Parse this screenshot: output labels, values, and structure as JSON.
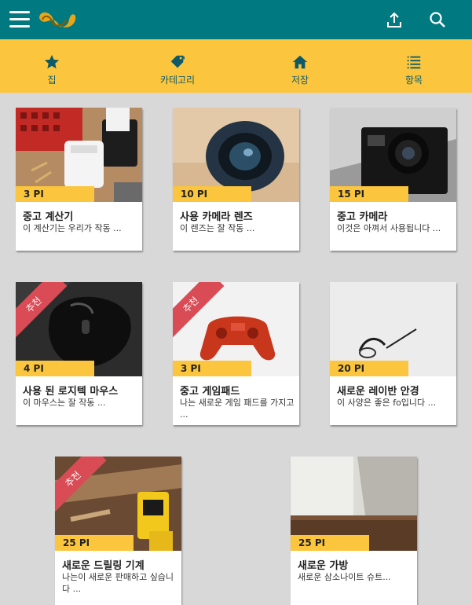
{
  "header": {
    "menu_icon": "hamburger-icon",
    "logo": "brand-logo",
    "share_icon": "upload-share-icon",
    "search_icon": "search-icon"
  },
  "tabs": [
    {
      "label": "집",
      "icon": "star-icon"
    },
    {
      "label": "카테고리",
      "icon": "tag-icon"
    },
    {
      "label": "저장",
      "icon": "home-icon"
    },
    {
      "label": "항목",
      "icon": "list-icon"
    }
  ],
  "products": [
    {
      "price": "3 PI",
      "title": "중고 계산기",
      "desc": "이 계산기는 우리가 작동 ...",
      "badge": ""
    },
    {
      "price": "10 PI",
      "title": "사용 카메라 렌즈",
      "desc": "이 렌즈는 잘 작동 ...",
      "badge": ""
    },
    {
      "price": "15 PI",
      "title": "중고 카메라",
      "desc": "이것은 아껴서 사용됩니다 ...",
      "badge": ""
    },
    {
      "price": "4 PI",
      "title": "사용 된 로지텍 마우스",
      "desc": "이 마우스는 잘 작동 ...",
      "badge": "추천"
    },
    {
      "price": "3 PI",
      "title": "중고 게임패드",
      "desc": "나는 새로운 게임 패드를 가지고 ...",
      "badge": "추천"
    },
    {
      "price": "20 PI",
      "title": "새로운 레이반 안경",
      "desc": "이 사양은 좋은 fo입니다 ...",
      "badge": ""
    },
    {
      "price": "25 PI",
      "title": "새로운 드릴링 기계",
      "desc": "나는이 새로운 판매하고 싶습니다 ...",
      "badge": "추천"
    },
    {
      "price": "25 PI",
      "title": "새로운 가방",
      "desc": "새로운 삼소나이트 슈트...",
      "badge": ""
    }
  ],
  "colors": {
    "teal": "#007a80",
    "yellow": "#fbc53d",
    "ribbon": "#d94c56"
  }
}
